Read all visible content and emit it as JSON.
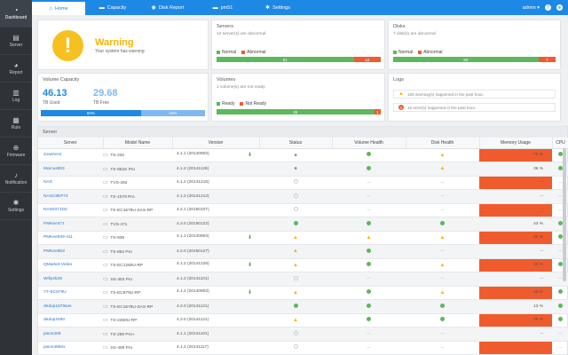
{
  "sidebar": {
    "items": [
      {
        "label": "Dashboard",
        "icon": "dashboard-icon",
        "glyph": "◔"
      },
      {
        "label": "Server",
        "icon": "server-icon",
        "glyph": "▤"
      },
      {
        "label": "Report",
        "icon": "report-icon",
        "glyph": "◕"
      },
      {
        "label": "Log",
        "icon": "log-icon",
        "glyph": "▥"
      },
      {
        "label": "Rule",
        "icon": "rule-icon",
        "glyph": "▦"
      },
      {
        "label": "Firmware",
        "icon": "firmware-icon",
        "glyph": "⊕"
      },
      {
        "label": "Notification",
        "icon": "bell-icon",
        "glyph": "♪"
      },
      {
        "label": "Settings",
        "icon": "gear-icon",
        "glyph": "✱"
      }
    ]
  },
  "topbar": {
    "tabs": [
      {
        "label": "Home",
        "glyph": "⌂"
      },
      {
        "label": "Capacity",
        "glyph": "▬"
      },
      {
        "label": "Disk Report",
        "glyph": "◉"
      },
      {
        "label": "pm51",
        "glyph": "▬"
      },
      {
        "label": "Settings",
        "glyph": "✱"
      }
    ],
    "user": "admin ▾"
  },
  "warning": {
    "title": "Warning",
    "message": "Your system has warning"
  },
  "servers": {
    "title": "Servers",
    "subtitle": "12 server(s) are abnormal",
    "legend_normal": "Normal",
    "legend_abnormal": "Abnormal",
    "normal": 61,
    "abnormal": 12
  },
  "disks": {
    "title": "Disks",
    "subtitle": "7 disk(s) are abnormal",
    "legend_normal": "Normal",
    "legend_abnormal": "Abnormal",
    "normal": 60,
    "abnormal": 7
  },
  "volume_capacity": {
    "title": "Volume Capacity",
    "used": "46.13",
    "used_label": "TB Used",
    "free": "29.68",
    "free_label": "TB Free",
    "used_pct": "60%",
    "free_pct": "40%"
  },
  "volumes": {
    "title": "Volumes",
    "subtitle": "1 volume(s) are not ready",
    "legend_ready": "Ready",
    "legend_not_ready": "Not Ready",
    "ready": 25,
    "not_ready": 1
  },
  "logs": {
    "title": "Logs",
    "items": [
      {
        "text": "159 warning(s) happened in the past hour.",
        "level": "warning"
      },
      {
        "text": "16 error(s) happened in the past hour.",
        "level": "error"
      }
    ]
  },
  "server_table": {
    "panel_title": "Server",
    "columns": [
      "Server",
      "Model Name",
      "Version",
      "Status",
      "Volume Health",
      "Disk Health",
      "Memory Usage",
      "CPU"
    ],
    "rows": [
      {
        "server": "JoanNAS",
        "model": "TS-220",
        "version": "4.1.1 (20140903)",
        "dl": true,
        "status": "lock",
        "vol": "ok",
        "disk": "warn",
        "mem": "70 %",
        "cpu": "ok"
      },
      {
        "server": "Marcus853",
        "model": "TS-853S Pro",
        "version": "4.1.2 (20141126)",
        "dl": false,
        "status": "lock",
        "vol": "ok",
        "disk": "warn",
        "mem": "36 %",
        "cpu": "ok"
      },
      {
        "server": "NAS",
        "model": "TVS-463",
        "version": "4.1.2 (20141216)",
        "dl": false,
        "status": "ring",
        "vol": "--",
        "disk": "--",
        "mem": "--",
        "cpu": "--"
      },
      {
        "server": "NASC8DF74",
        "model": "TS-1079 Pro",
        "version": "4.1.2 (20141212)",
        "dl": false,
        "status": "ring",
        "vol": "--",
        "disk": "--",
        "mem": "--",
        "cpu": "--"
      },
      {
        "server": "NAS0371D0",
        "model": "TS-EC1679U-SAS-RP",
        "version": "4.2.1 (20150107)",
        "dl": false,
        "status": "ring",
        "vol": "--",
        "disk": "--",
        "mem": "--",
        "cpu": "--"
      },
      {
        "server": "PMKee471",
        "model": "TVS-471",
        "version": "4.2.0 (20150122)",
        "dl": false,
        "status": "ok",
        "vol": "ok",
        "disk": "ok",
        "mem": "43 %",
        "cpu": "ok"
      },
      {
        "server": "PMKee939-411",
        "model": "TS-939",
        "version": "4.1.1 (20140903)",
        "dl": true,
        "status": "warn",
        "vol": "warn",
        "disk": "warn",
        "mem": "88 %",
        "cpu": "ok"
      },
      {
        "server": "PMKee853",
        "model": "TS-853 Pro",
        "version": "4.2.0 (20150127)",
        "dl": false,
        "status": "warn",
        "vol": "ok",
        "disk": "--",
        "mem": "--",
        "cpu": "--"
      },
      {
        "server": "QMarket-Video",
        "model": "TS-EC1280U-RP",
        "version": "4.1.2 (20141229)",
        "dl": true,
        "status": "warn",
        "vol": "ok",
        "disk": "warn",
        "mem": "35 %",
        "cpu": "ok"
      },
      {
        "server": "Willy453S",
        "model": "SS-453 Pro",
        "version": "4.1.2 (20141101)",
        "dl": false,
        "status": "ring",
        "vol": "--",
        "disk": "--",
        "mem": "--",
        "cpu": "--"
      },
      {
        "server": "YT-EC879U",
        "model": "TS-EC879U-RP",
        "version": "4.1.2 (20140903)",
        "dl": true,
        "status": "warn",
        "vol": "ok",
        "disk": "warn",
        "mem": "43 %",
        "cpu": "ok"
      },
      {
        "server": "dedup1679sas",
        "model": "TS-EC1679U-SAS-RP",
        "version": "4.2.0 (20141121)",
        "dl": false,
        "status": "ok",
        "vol": "ok",
        "disk": "ok",
        "mem": "13 %",
        "cpu": "ok"
      },
      {
        "server": "dedup2480",
        "model": "TS-2480U-RP",
        "version": "4.2.0 (20141121)",
        "dl": false,
        "status": "warn",
        "vol": "ok",
        "disk": "ok",
        "mem": "38 %",
        "cpu": "ok"
      },
      {
        "server": "jason259",
        "model": "TS-259 Pro+",
        "version": "4.1.1 (20141101)",
        "dl": false,
        "status": "ring",
        "vol": "--",
        "disk": "--",
        "mem": "--",
        "cpu": "--"
      },
      {
        "server": "jason469ex",
        "model": "SS-469 Pro",
        "version": "4.1.2 (20141117)",
        "dl": false,
        "status": "ring",
        "vol": "--",
        "disk": "--",
        "mem": "--",
        "cpu": "--"
      }
    ]
  },
  "colors": {
    "accent": "#1e88e5",
    "normal": "#5cb85c",
    "abnormal": "#f05b2e",
    "warning": "#f4b400",
    "used_bar": "#1e88e5",
    "free_bar": "#7fb8ef"
  }
}
